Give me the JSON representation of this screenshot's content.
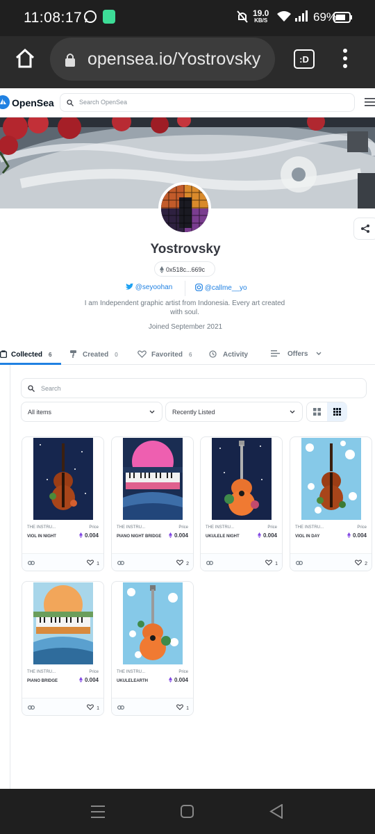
{
  "status_bar": {
    "time": "11:08:17",
    "net_speed_value": "19.0",
    "net_speed_unit": "KB/S",
    "battery": "69%"
  },
  "browser": {
    "url": "opensea.io/Yostrovsky",
    "tab_badge": ":D"
  },
  "header": {
    "logo_text": "OpenSea",
    "search_placeholder": "Search OpenSea"
  },
  "profile": {
    "name": "Yostrovsky",
    "address": "0x518c...669c",
    "twitter": "@seyoohan",
    "instagram": "@callme__yo",
    "bio": "I am Independent graphic artist from Indonesia. Every art created with soul.",
    "joined": "Joined September 2021"
  },
  "tabs": [
    {
      "label": "Collected",
      "count": "6"
    },
    {
      "label": "Created",
      "count": "0"
    },
    {
      "label": "Favorited",
      "count": "6"
    },
    {
      "label": "Activity",
      "count": ""
    },
    {
      "label": "Offers",
      "count": ""
    }
  ],
  "filters": {
    "search_placeholder": "Search",
    "items_select": "All items",
    "sort_select": "Recently Listed"
  },
  "items": [
    {
      "collection": "THE INSTRU...",
      "price_label": "Price",
      "title": "VIOL IN NIGHT",
      "price": "0.004",
      "likes": "1",
      "art": "viol-night"
    },
    {
      "collection": "THE INSTRU...",
      "price_label": "Price",
      "title": "PIANO NIGHT BRIDGE",
      "price": "0.004",
      "likes": "2",
      "art": "piano-night"
    },
    {
      "collection": "THE INSTRU...",
      "price_label": "Price",
      "title": "UKULELE NIGHT",
      "price": "0.004",
      "likes": "1",
      "art": "ukulele-night"
    },
    {
      "collection": "THE INSTRU...",
      "price_label": "Price",
      "title": "VIOL IN DAY",
      "price": "0.004",
      "likes": "2",
      "art": "viol-day"
    },
    {
      "collection": "THE INSTRU...",
      "price_label": "Price",
      "title": "PIANO BRIDGE",
      "price": "0.004",
      "likes": "1",
      "art": "piano-day"
    },
    {
      "collection": "THE INSTRU...",
      "price_label": "Price",
      "title": "UKULELEARTH",
      "price": "0.004",
      "likes": "1",
      "art": "ukulele-earth"
    }
  ]
}
